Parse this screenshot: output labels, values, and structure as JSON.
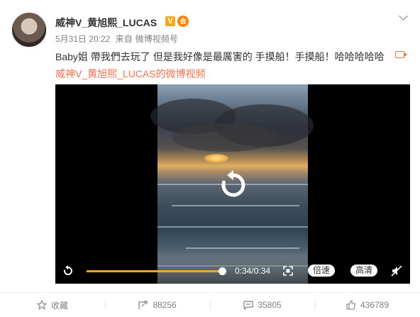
{
  "post": {
    "author": "威神V_黄旭熙_LUCAS",
    "verified_badge": "V",
    "vip_badge": "会",
    "date": "5月31日 20:22",
    "source_prefix": "来自",
    "source": "微博视频号",
    "text": "Baby姐 帶我們去玩了 但是我好像是最厲害的 手摸船！手摸船！哈哈哈哈哈",
    "video_link": "威神V_黄旭熙_LUCAS的微博视频"
  },
  "video": {
    "time": "0:34/0:34",
    "progress": 1.0,
    "speed_label": "倍速",
    "quality_label": "高清"
  },
  "actions": {
    "favorite": "收藏",
    "repost": "88256",
    "comment": "35805",
    "like": "436789"
  },
  "colors": {
    "accent": "#eb7350",
    "progress": "#f5a623",
    "vip": "#ff8200"
  }
}
